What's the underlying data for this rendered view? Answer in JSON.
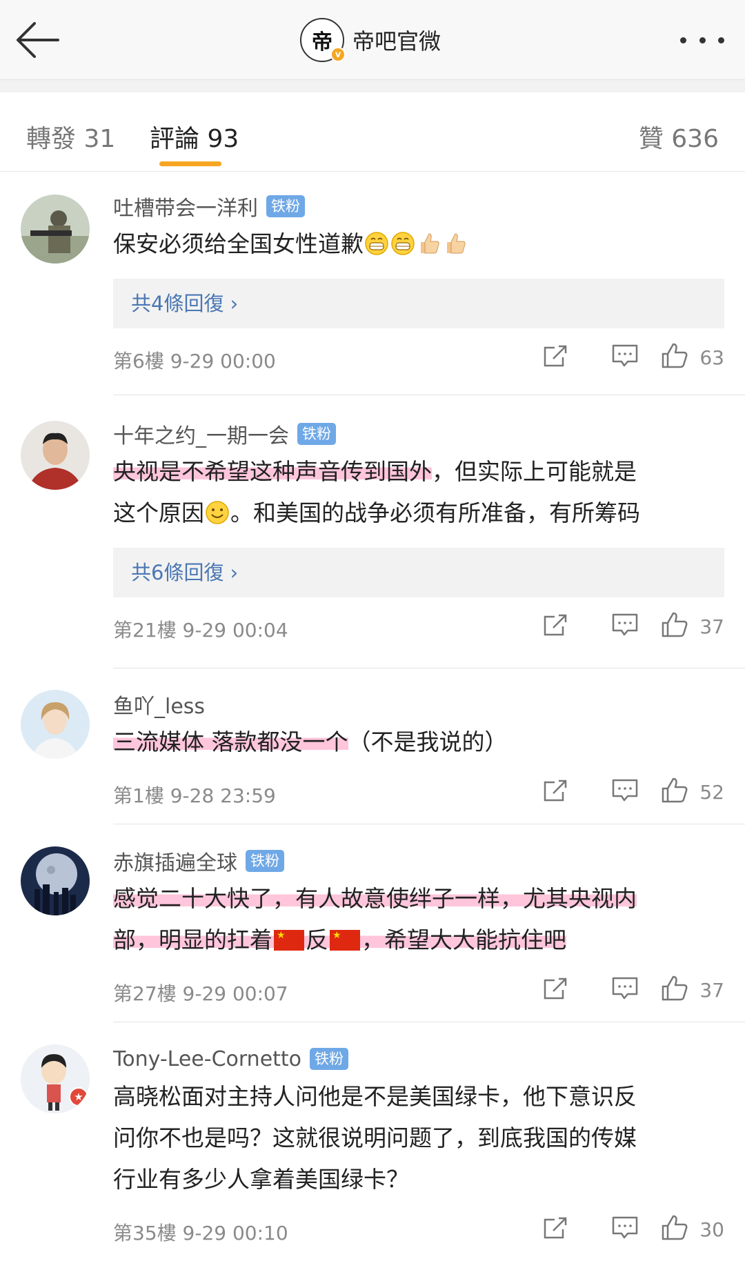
{
  "header": {
    "logo_char": "帝",
    "title": "帝吧官微"
  },
  "tabs": {
    "repost": "轉發 31",
    "comment": "評論 93",
    "like": "贊 636"
  },
  "colors": {
    "accent": "#f6a623",
    "fan_badge": "#6fa8e6",
    "link": "#4a77b3",
    "highlight": "#ff96be"
  },
  "comments": [
    {
      "user": "吐槽带会一洋利",
      "badge": "铁粉",
      "text_plain": "保安必须给全国女性道歉",
      "emojis": [
        "grin-emoji",
        "grin-emoji",
        "thumbs-up-emoji",
        "thumbs-up-emoji"
      ],
      "replies": "共4條回復",
      "floor": "第6樓 9-29 00:00",
      "likes": "63"
    },
    {
      "user": "十年之约_一期一会",
      "badge": "铁粉",
      "text_hl": "央视是不希望这种声音传到国外",
      "text_rest1": "，但实际上可能就是",
      "text_line2a": "这个原因",
      "text_line2b": "。和美国的战争必须有所准备，有所筹码",
      "emojis": [
        "smile-emoji"
      ],
      "replies": "共6條回復",
      "floor": "第21樓 9-29 00:04",
      "likes": "37"
    },
    {
      "user": "鱼吖_less",
      "text_hl": "三流媒体 落款都没一个",
      "text_rest": "（不是我说的）",
      "floor": "第1樓 9-28 23:59",
      "likes": "52"
    },
    {
      "user": "赤旗插遍全球",
      "badge": "铁粉",
      "text_line1": "感觉二十大快了，有人故意使绊子一样，尤其央视内",
      "text_line2a": "部，明显的扛着",
      "text_line2b": "反",
      "text_line2c": "，希望大大能抗住吧",
      "emojis": [
        "china-flag-emoji",
        "china-flag-emoji"
      ],
      "floor": "第27樓 9-29 00:07",
      "likes": "37"
    },
    {
      "user": "Tony-Lee-Cornetto",
      "badge": "铁粉",
      "text_line1": "高晓松面对主持人问他是不是美国绿卡，他下意识反",
      "text_line2": "问你不也是吗？这就很说明问题了，到底我国的传媒",
      "text_line3": "行业有多少人拿着美国绿卡？",
      "floor": "第35樓 9-29 00:10",
      "likes": "30"
    }
  ]
}
